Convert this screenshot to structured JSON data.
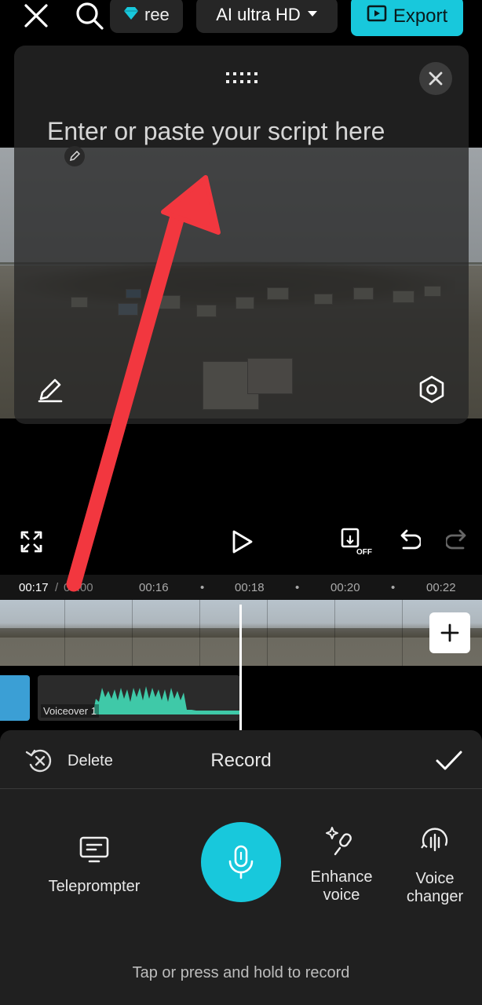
{
  "topbar": {
    "pro_label": "ree",
    "quality_label": "AI ultra HD",
    "export_label": "Export"
  },
  "script_panel": {
    "placeholder": "Enter or paste your script here"
  },
  "timeline": {
    "current_time": "00:17",
    "total_time": "04:00",
    "ticks": [
      "00:16",
      "00:18",
      "00:20",
      "00:22"
    ],
    "voiceover_label": "Voiceover 1"
  },
  "record_sheet": {
    "delete_label": "Delete",
    "title": "Record",
    "teleprompter_label": "Teleprompter",
    "enhance_label_1": "Enhance",
    "enhance_label_2": "voice",
    "changer_label_1": "Voice",
    "changer_label_2": "changer",
    "hint": "Tap or press and hold to record"
  },
  "colors": {
    "accent": "#18c8dc",
    "annotation_arrow": "#f2373f",
    "voice_wave": "#3fc9a8"
  }
}
